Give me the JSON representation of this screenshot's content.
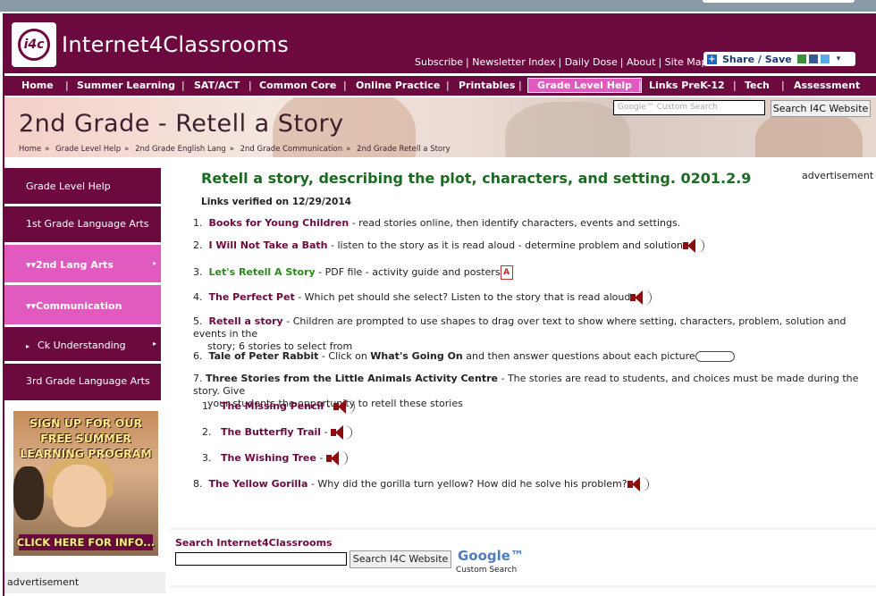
{
  "header": {
    "logo_badge": "i4c",
    "site_name": "Internet4Classrooms",
    "top_links": [
      "Subscribe",
      "Newsletter Index",
      "Daily Dose",
      "About",
      "Site Map"
    ],
    "share_label": "Share / Save"
  },
  "nav": {
    "items": [
      "Home",
      "Summer Learning",
      "SAT/ACT",
      "Common Core",
      "Online Practice",
      "Printables",
      "Grade Level Help",
      "Links PreK-12",
      "Tech",
      "Assessment"
    ],
    "active": "Grade Level Help"
  },
  "banner": {
    "title": "2nd Grade - Retell a Story",
    "breadcrumbs": [
      "Home",
      "»",
      "Grade Level Help",
      "»",
      "2nd Grade English Lang",
      "»",
      "2nd Grade Communication",
      "»",
      "2nd Grade Retell a Story"
    ],
    "search_placeholder": "Google™ Custom Search",
    "search_button": "Search I4C Website"
  },
  "sidebar": {
    "items": [
      {
        "label": "Grade Level Help",
        "style": "dark"
      },
      {
        "label": "1st Grade Language Arts",
        "style": "dark"
      },
      {
        "label": "2nd Lang Arts",
        "style": "pink",
        "prefix": "▾▾",
        "arrow": "▸"
      },
      {
        "label": "Communication",
        "style": "pink",
        "prefix": "▾▾"
      },
      {
        "label": "Ck Understanding",
        "style": "dark",
        "prefix": "▸",
        "arrow": "▸"
      },
      {
        "label": "3rd Grade Language Arts",
        "style": "dark"
      }
    ],
    "ad_lines": [
      "SIGN UP FOR OUR",
      "FREE SUMMER",
      "LEARNING PROGRAM"
    ],
    "ad_cta": "CLICK HERE FOR INFO...",
    "advertisement": "advertisement"
  },
  "main": {
    "heading": "Retell a story, describing the plot, characters, and setting. 0201.2.9",
    "advertisement": "advertisement",
    "verified": "Links verified on 12/29/2014",
    "items": [
      {
        "num": "1.",
        "title": "Books for Young Children",
        "desc": " - read stories online, then identify characters, events and settings."
      },
      {
        "num": "2.",
        "title": "I Will Not Take a Bath",
        "desc": " - listen to the story as it is read aloud - determine problem and solution"
      },
      {
        "num": "3.",
        "title": "Let's Retell A Story",
        "desc": " - PDF file - activity guide and posters"
      },
      {
        "num": "4.",
        "title": "The Perfect Pet",
        "desc": " - Which pet should she select? Listen to the story that is read aloud"
      },
      {
        "num": "5.",
        "title": "Retell a story",
        "desc": " - Children are prompted to use shapes to drag over text to show where setting, characters, problem, solution and events in the",
        "desc2": "story; 6 stories to select from"
      },
      {
        "num": "6.",
        "title": "Tale of Peter Rabbit",
        "desc_a": " - Click on ",
        "desc_b": "What's Going On",
        "desc_c": "  and then answer questions about each picture"
      },
      {
        "num": "7.",
        "title": "Three Stories from the Little Animals Activity Centre",
        "desc": "  - The stories are read to students, and choices must be made during the story. Give",
        "desc2": "your students the opportunity to retell these stories"
      },
      {
        "num": "8.",
        "title": "The Yellow Gorilla",
        "desc": " - Why did the gorilla turn yellow? How did he solve his problem?"
      }
    ],
    "subitems": [
      {
        "num": "1.",
        "title": "The Missing Pencil"
      },
      {
        "num": "2.",
        "title": "The Butterfly Trail"
      },
      {
        "num": "3.",
        "title": "The Wishing Tree"
      }
    ]
  },
  "footer_search": {
    "label": "Search Internet4Classrooms",
    "button": "Search I4C Website",
    "google": "Google™",
    "custom": "Custom Search"
  }
}
